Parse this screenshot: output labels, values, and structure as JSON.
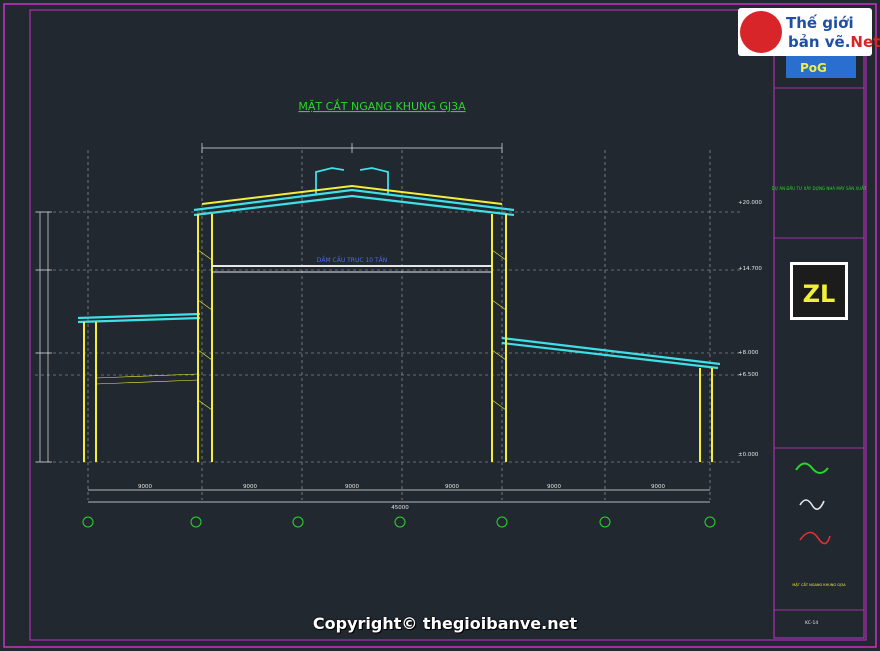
{
  "drawing": {
    "title": "MẶT CẮT NGANG KHUNG GJ3A",
    "elevations": [
      "+20.000",
      "+14.700",
      "+8.000",
      "+6.500",
      "±0.000"
    ],
    "crane_label": "DẦM CẦU TRỤC 10 TẤN",
    "span_labels": [
      "9000",
      "9000",
      "9000",
      "9000",
      "9000",
      "9000"
    ],
    "total_span": "45000"
  },
  "title_block": {
    "brand": "PoG",
    "project_label": "DỰ ÁN ĐẦU TƯ XÂY DỰNG NHÀ MÁY SẢN XUẤT",
    "section": "MẶT CẮT NGANG KHUNG GJ3A",
    "sheet_no": "KC-14"
  },
  "watermark": {
    "site_line1": "Thế giới",
    "site_line2": "bản vẽ.",
    "site_tld": "Net",
    "copyright": "Copyright© thegioibanve.net"
  },
  "colors": {
    "background": "#212830",
    "frame_yellow": "#f2ef3c",
    "roof_cyan": "#3ee0e6",
    "dim_white": "#e6e6e6",
    "text_green": "#2bd62b",
    "border_magenta": "#c832c8"
  }
}
